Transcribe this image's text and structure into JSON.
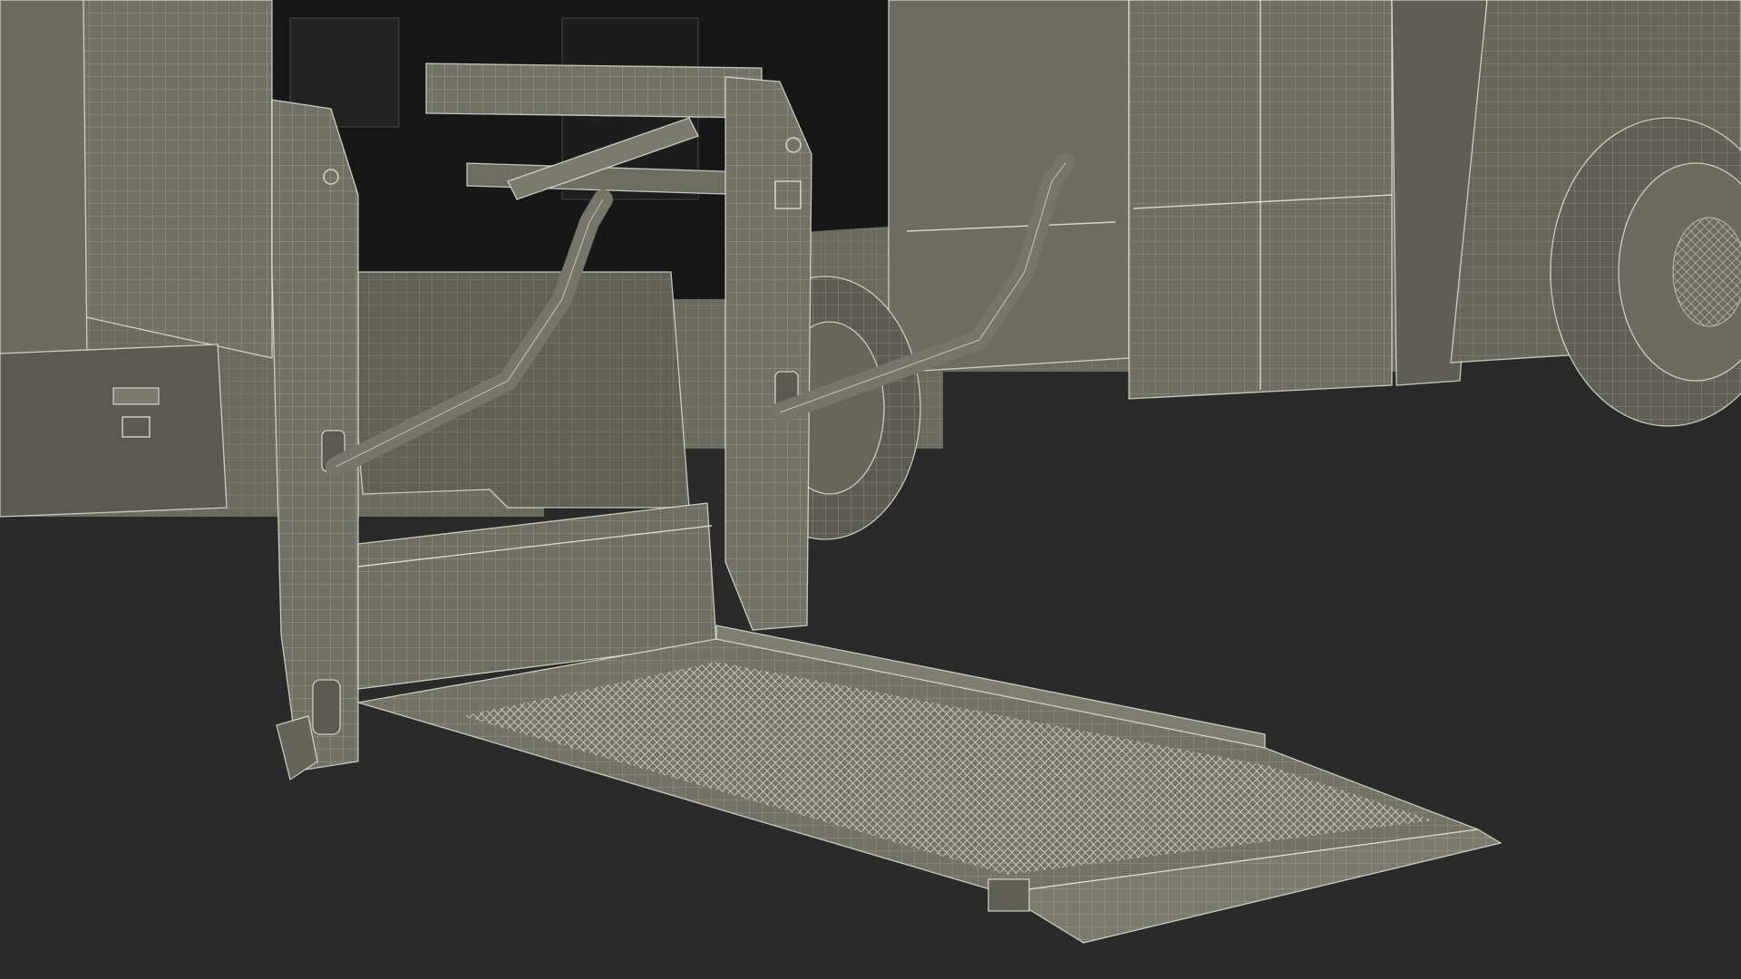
{
  "scene": {
    "subject": "wheelchair-lift-wireframe",
    "colors": {
      "background": "#2a2a2a",
      "body": "#6e6e64",
      "body_dark": "#55554d",
      "body_light": "#7d7d72",
      "interior": "#161616",
      "wire": "#eeeedd",
      "platform": "#7a7a6f"
    }
  }
}
